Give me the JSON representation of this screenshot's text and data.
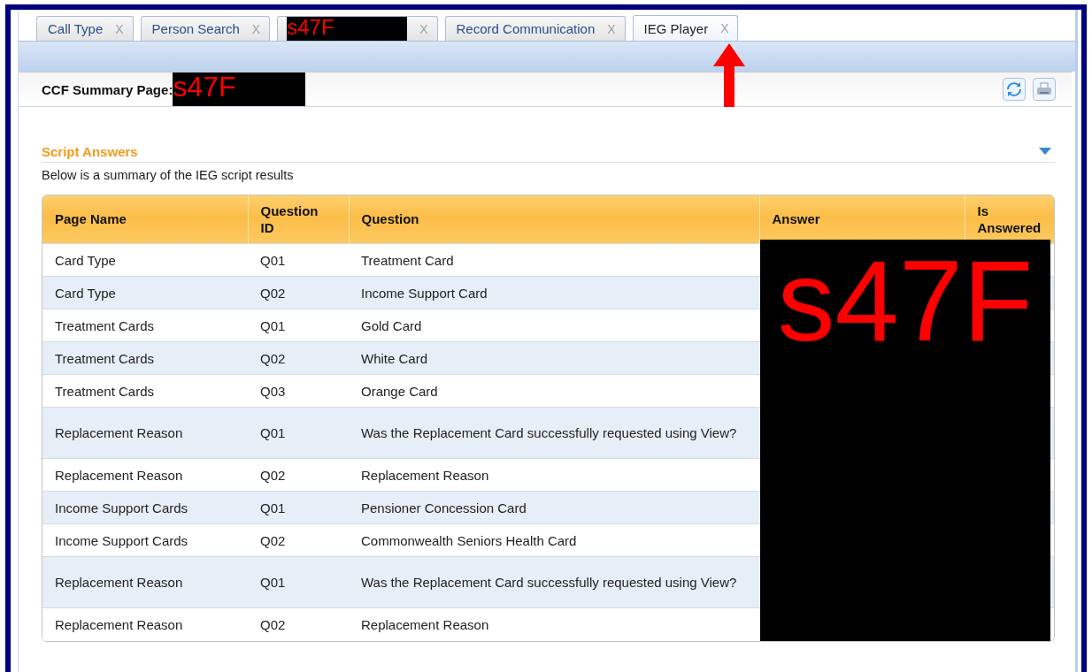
{
  "tabs": [
    {
      "kind": "text",
      "label": "Call Type",
      "close": "X",
      "selected": false
    },
    {
      "kind": "text",
      "label": "Person Search",
      "close": "X",
      "selected": false
    },
    {
      "kind": "redacted",
      "label": "s47F",
      "close": "X",
      "selected": false
    },
    {
      "kind": "text",
      "label": "Record Communication",
      "close": "X",
      "selected": false
    },
    {
      "kind": "text",
      "label": "IEG Player",
      "close": "X",
      "selected": true
    }
  ],
  "header": {
    "title": "CCF Summary Page:",
    "redaction": "s47F"
  },
  "section": {
    "title": "Script Answers",
    "expanded": true,
    "description": "Below is a summary of the IEG script results"
  },
  "table": {
    "columns": [
      "Page Name",
      "Question ID",
      "Question",
      "Answer",
      "Is Answered"
    ],
    "redaction": "s47F",
    "rows": [
      {
        "page_name": "Card Type",
        "question_id": "Q01",
        "question": "Treatment Card"
      },
      {
        "page_name": "Card Type",
        "question_id": "Q02",
        "question": "Income Support Card"
      },
      {
        "page_name": "Treatment Cards",
        "question_id": "Q01",
        "question": "Gold Card"
      },
      {
        "page_name": "Treatment Cards",
        "question_id": "Q02",
        "question": "White Card"
      },
      {
        "page_name": "Treatment Cards",
        "question_id": "Q03",
        "question": "Orange Card"
      },
      {
        "page_name": "Replacement Reason",
        "question_id": "Q01",
        "question": "Was the Replacement Card successfully requested using View?"
      },
      {
        "page_name": "Replacement Reason",
        "question_id": "Q02",
        "question": "Replacement Reason"
      },
      {
        "page_name": "Income Support Cards",
        "question_id": "Q01",
        "question": "Pensioner Concession Card"
      },
      {
        "page_name": "Income Support Cards",
        "question_id": "Q02",
        "question": "Commonwealth Seniors Health Card"
      },
      {
        "page_name": "Replacement Reason",
        "question_id": "Q01",
        "question": "Was the Replacement Card successfully requested using View?"
      },
      {
        "page_name": "Replacement Reason",
        "question_id": "Q02",
        "question": "Replacement Reason"
      }
    ]
  }
}
